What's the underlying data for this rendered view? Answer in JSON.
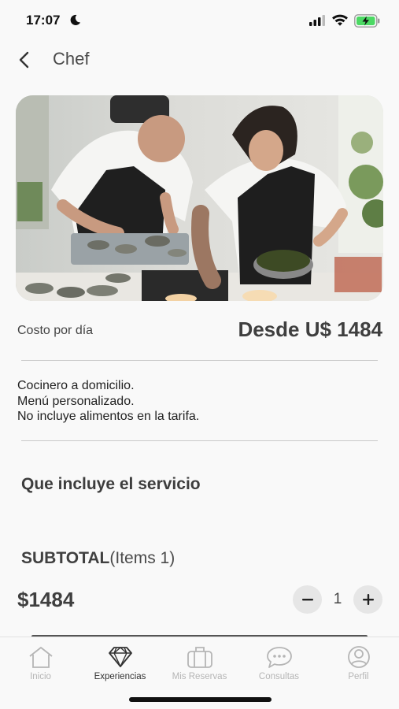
{
  "status_bar": {
    "time": "17:07",
    "icons": [
      "moon-icon",
      "signal-icon",
      "wifi-icon",
      "battery-charging-icon"
    ]
  },
  "header": {
    "back_icon": "chevron-left-icon",
    "title": "Chef"
  },
  "hero_image": {
    "icon": "chefs-preparing-oysters-photo"
  },
  "price": {
    "label": "Costo por día",
    "value": "Desde U$ 1484"
  },
  "description": [
    "Cocinero a domicilio.",
    "Menú personalizado.",
    "No incluye alimentos en la tarifa."
  ],
  "includes": {
    "title": "Que incluye el servicio"
  },
  "subtotal": {
    "label": "SUBTOTAL",
    "items": "(Items 1)",
    "amount": "$1484"
  },
  "stepper": {
    "quantity": "1",
    "minus_icon": "minus-icon",
    "plus_icon": "plus-icon"
  },
  "tabs": [
    {
      "label": "Inicio",
      "icon": "home-icon",
      "active": false
    },
    {
      "label": "Experiencias",
      "icon": "diamond-icon",
      "active": true
    },
    {
      "label": "Mis Reservas",
      "icon": "suitcase-icon",
      "active": false
    },
    {
      "label": "Consultas",
      "icon": "chat-bubble-icon",
      "active": false
    },
    {
      "label": "Perfil",
      "icon": "user-icon",
      "active": false
    }
  ],
  "colors": {
    "background": "#f9f9f9",
    "text_dark": "#3d3d3d",
    "divider": "#c9c9c9",
    "tab_inactive": "#b5b5b5",
    "tab_active": "#333333",
    "battery_green": "#4cd964"
  }
}
